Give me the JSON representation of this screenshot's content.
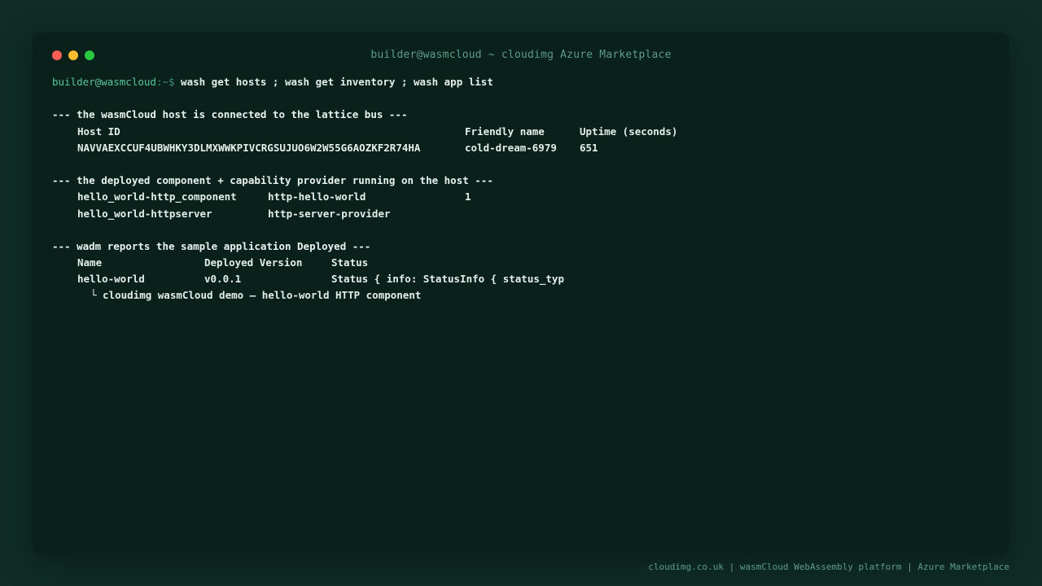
{
  "window": {
    "title": "builder@wasmcloud ~ cloudimg Azure Marketplace"
  },
  "prompt": {
    "user_host": "builder@wasmcloud",
    "path": ":~$",
    "command": "wash get hosts ; wash get inventory ; wash app list"
  },
  "hosts_section": {
    "heading": "--- the wasmCloud host is connected to the lattice bus ---",
    "columns": [
      "Host ID",
      "Friendly name",
      "Uptime (seconds)"
    ],
    "rows": [
      [
        "NAVVAEXCCUF4UBWHKY3DLMXWWKPIVCRGSUJUO6W2W55G6AOZKF2R74HA",
        "cold-dream-6979",
        "651"
      ]
    ]
  },
  "inventory_section": {
    "heading": "--- the deployed component + capability provider running on the host ---",
    "rows": [
      [
        "hello_world-http_component",
        "http-hello-world",
        "1"
      ],
      [
        "hello_world-httpserver",
        "http-server-provider",
        ""
      ]
    ]
  },
  "apps_section": {
    "heading": "--- wadm reports the sample application Deployed ---",
    "columns": [
      "Name",
      "Deployed Version",
      "Status"
    ],
    "rows": [
      [
        "hello-world",
        "v0.0.1",
        "Status { info: StatusInfo { status_typ"
      ]
    ],
    "note": "└ cloudimg wasmCloud demo — hello-world HTTP component"
  },
  "footer": "cloudimg.co.uk | wasmCloud WebAssembly platform | Azure Marketplace",
  "colors": {
    "background": "#0f2c26",
    "window": "#0a201b",
    "prompt_user": "#58c79c",
    "text": "#e4efe9",
    "muted": "#5e9c86"
  }
}
